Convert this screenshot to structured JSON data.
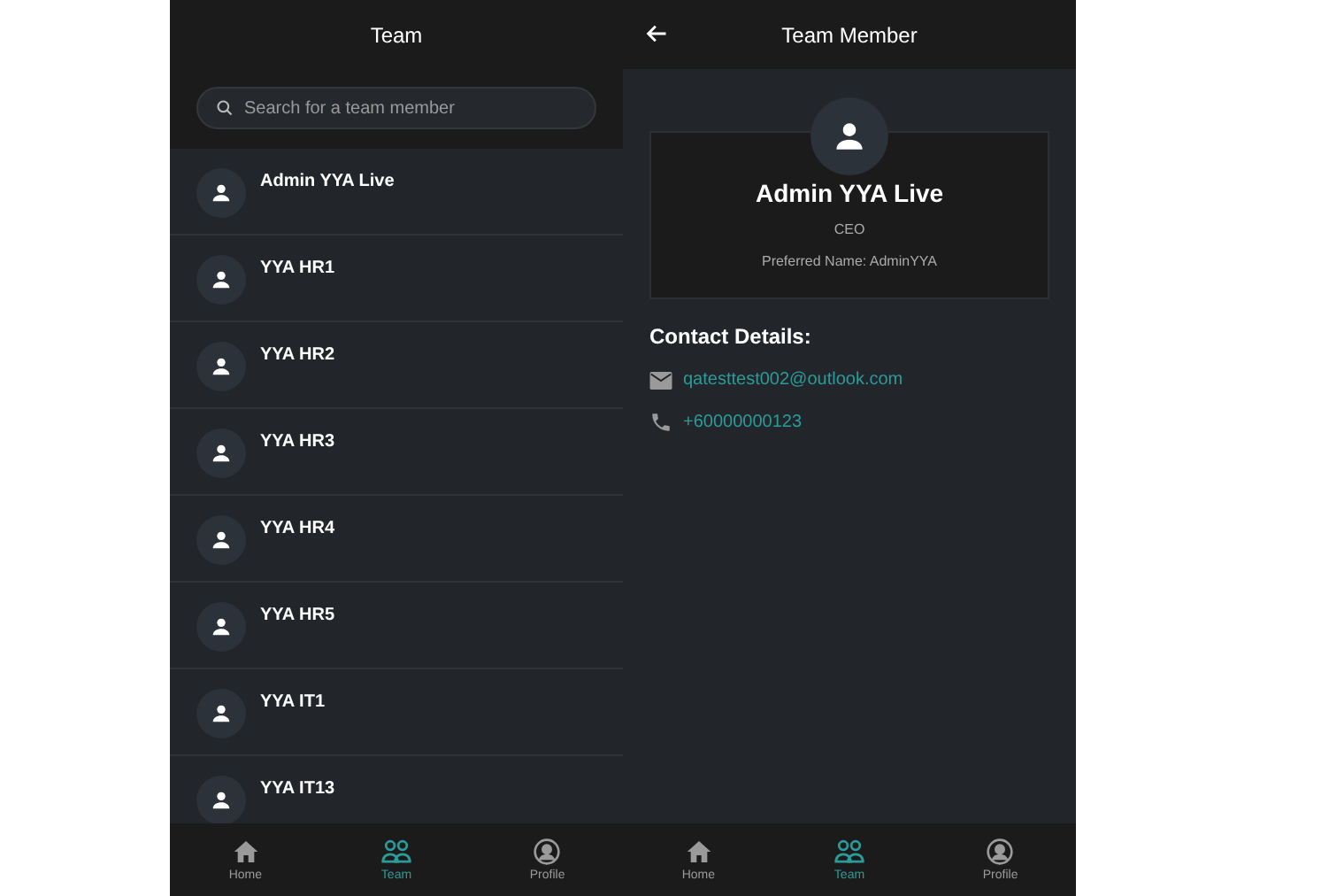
{
  "team_screen": {
    "title": "Team",
    "search": {
      "placeholder": "Search for a team member"
    },
    "members": [
      {
        "name": "Admin YYA Live"
      },
      {
        "name": "YYA HR1"
      },
      {
        "name": "YYA HR2"
      },
      {
        "name": "YYA HR3"
      },
      {
        "name": "YYA HR4"
      },
      {
        "name": "YYA HR5"
      },
      {
        "name": "YYA IT1"
      },
      {
        "name": "YYA IT13"
      }
    ],
    "nav": [
      {
        "kind": "home",
        "label": "Home",
        "selected": false
      },
      {
        "kind": "team",
        "label": "Team",
        "selected": true
      },
      {
        "kind": "profile",
        "label": "Profile",
        "selected": false
      }
    ]
  },
  "member_screen": {
    "title": "Team Member",
    "name": "Admin YYA Live",
    "role": "CEO",
    "preferred_name": "Preferred Name: AdminYYA",
    "contact_heading": "Contact Details:",
    "contacts": [
      {
        "kind": "email",
        "value": "qatesttest002@outlook.com"
      },
      {
        "kind": "phone",
        "value": "+60000000123"
      }
    ],
    "nav": [
      {
        "kind": "home",
        "label": "Home",
        "selected": false
      },
      {
        "kind": "team",
        "label": "Team",
        "selected": true
      },
      {
        "kind": "profile",
        "label": "Profile",
        "selected": false
      }
    ]
  }
}
